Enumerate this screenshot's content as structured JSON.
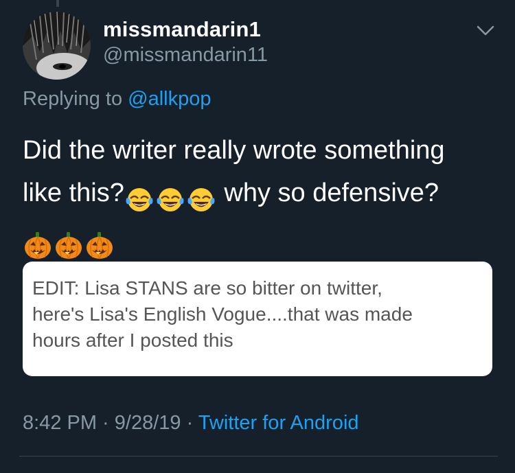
{
  "user": {
    "display_name": "missmandarin1",
    "handle": "@missmandarin11"
  },
  "reply": {
    "prefix": "Replying to ",
    "mention": "@allkpop"
  },
  "tweet": {
    "line1": "Did the writer really wrote something",
    "line2_a": "like this?",
    "line2_b": " why so defensive?",
    "emojis_line2": [
      "face-with-tears-of-joy",
      "face-with-tears-of-joy",
      "face-with-tears-of-joy"
    ],
    "emojis_line3": [
      "jack-o-lantern",
      "jack-o-lantern",
      "jack-o-lantern"
    ]
  },
  "image_card": {
    "line1": "EDIT: Lisa STANS are so bitter on twitter,",
    "line2": "here's Lisa's English Vogue....that was made",
    "line3": "hours after I posted this"
  },
  "meta": {
    "time": "8:42 PM",
    "separator1": " · ",
    "date": "9/28/19",
    "separator2": " · ",
    "source": "Twitter for Android"
  },
  "colors": {
    "background": "#15202b",
    "secondary_text": "#8899a6",
    "accent": "#1da1f2"
  }
}
